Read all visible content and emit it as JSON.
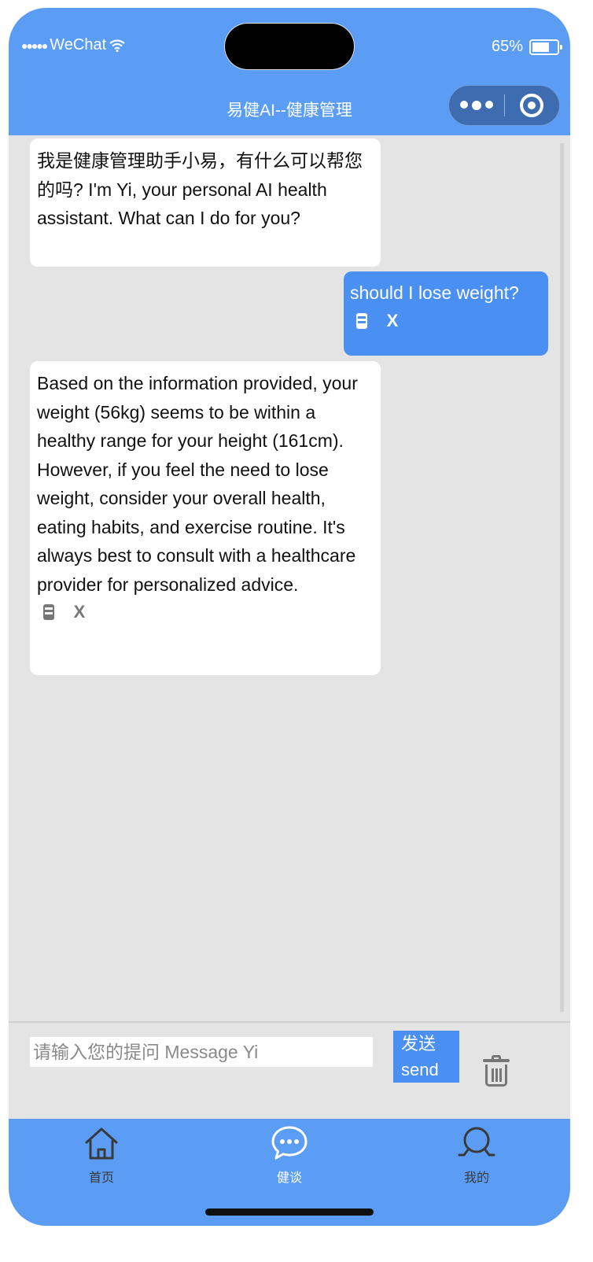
{
  "status_bar": {
    "signal": "●●●●●",
    "carrier": "WeChat",
    "battery_percent": "65%",
    "battery_level": 0.65
  },
  "nav": {
    "title": "易健AI--健康管理"
  },
  "messages": [
    {
      "role": "assistant",
      "text": "我是健康管理助手小易，有什么可以帮您的吗? I'm Yi, your personal AI health assistant. What can I do for you?"
    },
    {
      "role": "user",
      "text": "should I lose weight?"
    },
    {
      "role": "assistant",
      "text": "Based on the information provided, your weight (56kg) seems to be within a healthy range for your height (161cm). However, if you feel the need to lose weight, consider your overall health, eating habits, and exercise routine. It's always best to consult with a healthcare provider for personalized advice."
    }
  ],
  "input": {
    "placeholder": "请输入您的提问 Message Yi",
    "value": "",
    "send_label_cn": "发送",
    "send_label_en": "send"
  },
  "tabs": [
    {
      "label": "首页",
      "icon": "home-icon",
      "active": false
    },
    {
      "label": "健谈",
      "icon": "chat-icon",
      "active": true
    },
    {
      "label": "我的",
      "icon": "profile-icon",
      "active": false
    }
  ],
  "colors": {
    "primary": "#5b9df5",
    "user_bubble": "#4a90f2",
    "chat_background": "#e4e4e4",
    "tab_inactive": "#3a3a3a",
    "tab_active": "#ffffff"
  }
}
